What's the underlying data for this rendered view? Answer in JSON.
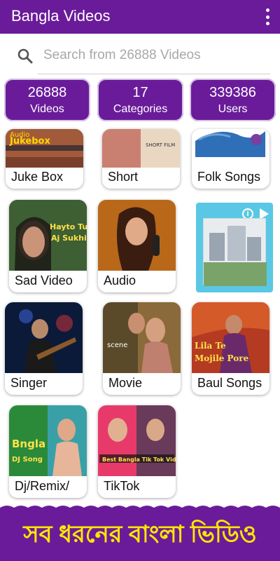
{
  "app": {
    "title": "Bangla Videos"
  },
  "search": {
    "placeholder": "Search from 26888 Videos"
  },
  "stats": [
    {
      "value": "26888",
      "label": "Videos"
    },
    {
      "value": "17",
      "label": "Categories"
    },
    {
      "value": "339386",
      "label": "Users"
    }
  ],
  "categories": [
    {
      "label": "Juke Box"
    },
    {
      "label": "Short"
    },
    {
      "label": "Folk Songs"
    },
    {
      "label": "Sad Video"
    },
    {
      "label": "Audio"
    },
    {
      "label": "Singer"
    },
    {
      "label": "Movie"
    },
    {
      "label": "Baul Songs"
    },
    {
      "label": "Dj/Remix/"
    },
    {
      "label": "TikTok"
    }
  ],
  "banner": {
    "text": "সব ধরনের বাংলা ভিডিও"
  },
  "colors": {
    "primary": "#6a1b9a",
    "banner_text": "#ffe600",
    "ad_bg": "#5ac8e4"
  }
}
